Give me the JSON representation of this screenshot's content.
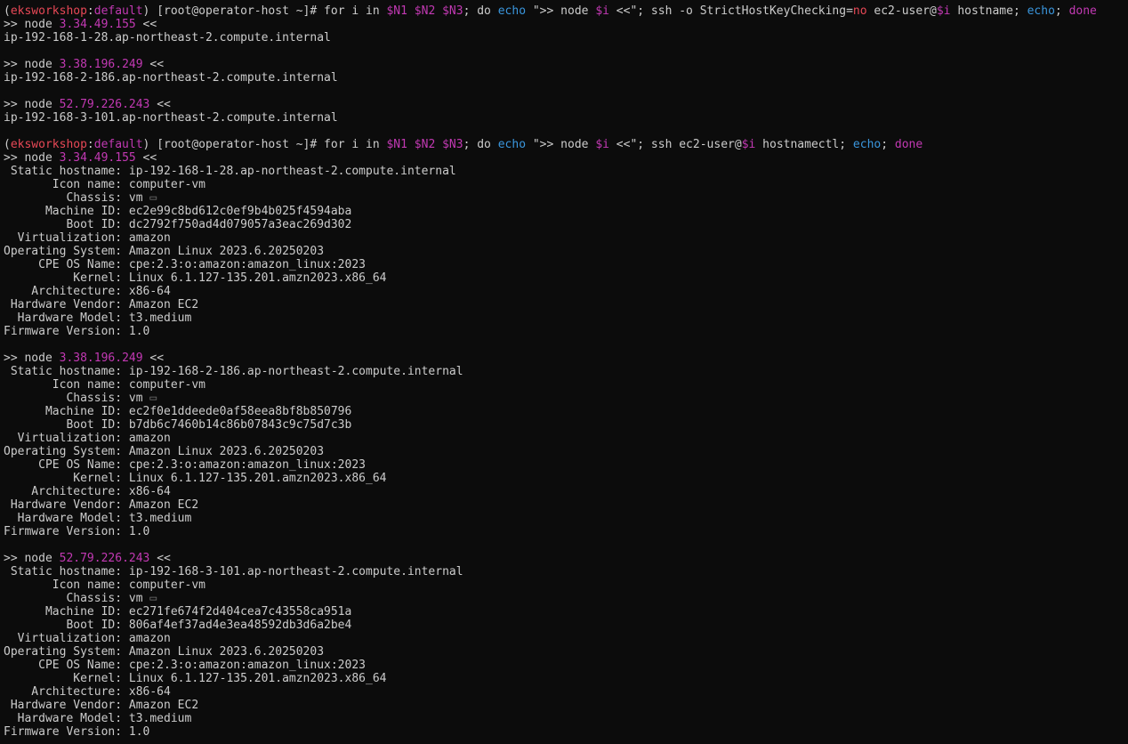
{
  "colors": {
    "background": "#0c0c0c",
    "foreground": "#cccccc",
    "context": "#e74856",
    "keyword": "#3a96dd",
    "variable": "#c239b3"
  },
  "lines": [
    [
      [
        "(",
        "c-default"
      ],
      [
        "eksworkshop",
        "c-ctx"
      ],
      [
        ":",
        "c-default"
      ],
      [
        "default",
        "c-var"
      ],
      [
        ") [root@operator-host ~]# for i in ",
        "c-default"
      ],
      [
        "$N1 $N2 $N3",
        "c-var"
      ],
      [
        "; do ",
        "c-default"
      ],
      [
        "echo",
        "c-kw"
      ],
      [
        " \">> node ",
        "c-default"
      ],
      [
        "$i",
        "c-var"
      ],
      [
        " <<\"; ssh -o StrictHostKeyChecking=",
        "c-default"
      ],
      [
        "no",
        "c-no"
      ],
      [
        " ec2-user@",
        "c-default"
      ],
      [
        "$i",
        "c-var"
      ],
      [
        " hostname; ",
        "c-default"
      ],
      [
        "echo",
        "c-kw"
      ],
      [
        "; ",
        "c-default"
      ],
      [
        "done",
        "c-done"
      ]
    ],
    [
      [
        ">> node ",
        "c-default"
      ],
      [
        "3.34.49.155",
        "c-ip"
      ],
      [
        " <<",
        "c-default"
      ]
    ],
    [
      [
        "ip-192-168-1-28.ap-northeast-2.compute.internal",
        "c-default"
      ]
    ],
    [],
    [
      [
        ">> node ",
        "c-default"
      ],
      [
        "3.38.196.249",
        "c-ip"
      ],
      [
        " <<",
        "c-default"
      ]
    ],
    [
      [
        "ip-192-168-2-186.ap-northeast-2.compute.internal",
        "c-default"
      ]
    ],
    [],
    [
      [
        ">> node ",
        "c-default"
      ],
      [
        "52.79.226.243",
        "c-ip"
      ],
      [
        " <<",
        "c-default"
      ]
    ],
    [
      [
        "ip-192-168-3-101.ap-northeast-2.compute.internal",
        "c-default"
      ]
    ],
    [],
    [
      [
        "(",
        "c-default"
      ],
      [
        "eksworkshop",
        "c-ctx"
      ],
      [
        ":",
        "c-default"
      ],
      [
        "default",
        "c-var"
      ],
      [
        ") [root@operator-host ~]# for i in ",
        "c-default"
      ],
      [
        "$N1 $N2 $N3",
        "c-var"
      ],
      [
        "; do ",
        "c-default"
      ],
      [
        "echo",
        "c-kw"
      ],
      [
        " \">> node ",
        "c-default"
      ],
      [
        "$i",
        "c-var"
      ],
      [
        " <<\"; ssh ec2-user@",
        "c-default"
      ],
      [
        "$i",
        "c-var"
      ],
      [
        " hostnamectl; ",
        "c-default"
      ],
      [
        "echo",
        "c-kw"
      ],
      [
        "; ",
        "c-default"
      ],
      [
        "done",
        "c-done"
      ]
    ],
    [
      [
        ">> node ",
        "c-default"
      ],
      [
        "3.34.49.155",
        "c-ip"
      ],
      [
        " <<",
        "c-default"
      ]
    ],
    [
      [
        " Static hostname: ip-192-168-1-28.ap-northeast-2.compute.internal",
        "c-default"
      ]
    ],
    [
      [
        "       Icon name: computer-vm",
        "c-default"
      ]
    ],
    [
      [
        "         Chassis: vm ",
        "c-default"
      ],
      [
        "▭",
        "c-icon"
      ]
    ],
    [
      [
        "      Machine ID: ec2e99c8bd612c0ef9b4b025f4594aba",
        "c-default"
      ]
    ],
    [
      [
        "         Boot ID: dc2792f750ad4d079057a3eac269d302",
        "c-default"
      ]
    ],
    [
      [
        "  Virtualization: amazon",
        "c-default"
      ]
    ],
    [
      [
        "Operating System: Amazon Linux 2023.6.20250203",
        "c-default"
      ]
    ],
    [
      [
        "     CPE OS Name: cpe:2.3:o:amazon:amazon_linux:2023",
        "c-default"
      ]
    ],
    [
      [
        "          Kernel: Linux 6.1.127-135.201.amzn2023.x86_64",
        "c-default"
      ]
    ],
    [
      [
        "    Architecture: x86-64",
        "c-default"
      ]
    ],
    [
      [
        " Hardware Vendor: Amazon EC2",
        "c-default"
      ]
    ],
    [
      [
        "  Hardware Model: t3.medium",
        "c-default"
      ]
    ],
    [
      [
        "Firmware Version: 1.0",
        "c-default"
      ]
    ],
    [],
    [
      [
        ">> node ",
        "c-default"
      ],
      [
        "3.38.196.249",
        "c-ip"
      ],
      [
        " <<",
        "c-default"
      ]
    ],
    [
      [
        " Static hostname: ip-192-168-2-186.ap-northeast-2.compute.internal",
        "c-default"
      ]
    ],
    [
      [
        "       Icon name: computer-vm",
        "c-default"
      ]
    ],
    [
      [
        "         Chassis: vm ",
        "c-default"
      ],
      [
        "▭",
        "c-icon"
      ]
    ],
    [
      [
        "      Machine ID: ec2f0e1ddeede0af58eea8bf8b850796",
        "c-default"
      ]
    ],
    [
      [
        "         Boot ID: b7db6c7460b14c86b07843c9c75d7c3b",
        "c-default"
      ]
    ],
    [
      [
        "  Virtualization: amazon",
        "c-default"
      ]
    ],
    [
      [
        "Operating System: Amazon Linux 2023.6.20250203",
        "c-default"
      ]
    ],
    [
      [
        "     CPE OS Name: cpe:2.3:o:amazon:amazon_linux:2023",
        "c-default"
      ]
    ],
    [
      [
        "          Kernel: Linux 6.1.127-135.201.amzn2023.x86_64",
        "c-default"
      ]
    ],
    [
      [
        "    Architecture: x86-64",
        "c-default"
      ]
    ],
    [
      [
        " Hardware Vendor: Amazon EC2",
        "c-default"
      ]
    ],
    [
      [
        "  Hardware Model: t3.medium",
        "c-default"
      ]
    ],
    [
      [
        "Firmware Version: 1.0",
        "c-default"
      ]
    ],
    [],
    [
      [
        ">> node ",
        "c-default"
      ],
      [
        "52.79.226.243",
        "c-ip"
      ],
      [
        " <<",
        "c-default"
      ]
    ],
    [
      [
        " Static hostname: ip-192-168-3-101.ap-northeast-2.compute.internal",
        "c-default"
      ]
    ],
    [
      [
        "       Icon name: computer-vm",
        "c-default"
      ]
    ],
    [
      [
        "         Chassis: vm ",
        "c-default"
      ],
      [
        "▭",
        "c-icon"
      ]
    ],
    [
      [
        "      Machine ID: ec271fe674f2d404cea7c43558ca951a",
        "c-default"
      ]
    ],
    [
      [
        "         Boot ID: 806af4ef37ad4e3ea48592db3d6a2be4",
        "c-default"
      ]
    ],
    [
      [
        "  Virtualization: amazon",
        "c-default"
      ]
    ],
    [
      [
        "Operating System: Amazon Linux 2023.6.20250203",
        "c-default"
      ]
    ],
    [
      [
        "     CPE OS Name: cpe:2.3:o:amazon:amazon_linux:2023",
        "c-default"
      ]
    ],
    [
      [
        "          Kernel: Linux 6.1.127-135.201.amzn2023.x86_64",
        "c-default"
      ]
    ],
    [
      [
        "    Architecture: x86-64",
        "c-default"
      ]
    ],
    [
      [
        " Hardware Vendor: Amazon EC2",
        "c-default"
      ]
    ],
    [
      [
        "  Hardware Model: t3.medium",
        "c-default"
      ]
    ],
    [
      [
        "Firmware Version: 1.0",
        "c-default"
      ]
    ]
  ]
}
